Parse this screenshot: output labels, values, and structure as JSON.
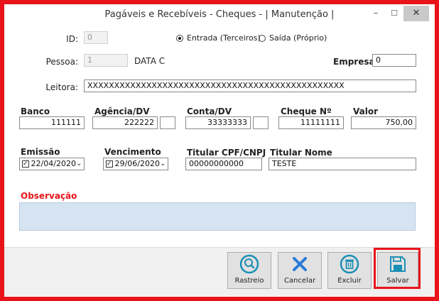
{
  "window": {
    "title": "Pagáveis e Recebíveis - Cheques - | Manutenção |",
    "min_glyph": "–",
    "max_glyph": "☐",
    "close_glyph": "✕"
  },
  "form": {
    "id_label": "ID:",
    "id_value": "0",
    "radio_entrada_label": "Entrada (Terceiros)",
    "radio_saida_label": "Saída (Próprio)",
    "radio_selected": "entrada",
    "pessoa_label": "Pessoa:",
    "pessoa_value": "1",
    "pessoa_name": "DATA C",
    "empresa_label": "Empresa:",
    "empresa_value": "0",
    "leitora_label": "Leitora:",
    "leitora_value": "XXXXXXXXXXXXXXXXXXXXXXXXXXXXXXXXXXXXXXXXXXXXXXXX",
    "banco_label": "Banco",
    "banco_value": "111111",
    "agencia_label": "Agência/DV",
    "agencia_value": "222222",
    "agencia_dv": "",
    "conta_label": "Conta/DV",
    "conta_value": "33333333",
    "conta_dv": "",
    "cheque_label": "Cheque Nº",
    "cheque_value": "11111111",
    "valor_label": "Valor",
    "valor_value": "750,00",
    "emissao_label": "Emissão",
    "emissao_value": "22/04/2020",
    "vencimento_label": "Vencimento",
    "vencimento_value": "29/06/2020",
    "cpf_label": "Titular CPF/CNPJ",
    "cpf_value": "00000000000",
    "nome_label": "Titular Nome",
    "nome_value": "TESTE",
    "observacao_label": "Observação",
    "observacao_value": ""
  },
  "toolbar": {
    "rastreio_label": "Rastreio",
    "cancelar_label": "Cancelar",
    "excluir_label": "Excluir",
    "salvar_label": "Salvar"
  },
  "colors": {
    "highlight": "#e8141a",
    "icon_teal": "#1a8fb5",
    "icon_blue": "#2b7bd6"
  }
}
